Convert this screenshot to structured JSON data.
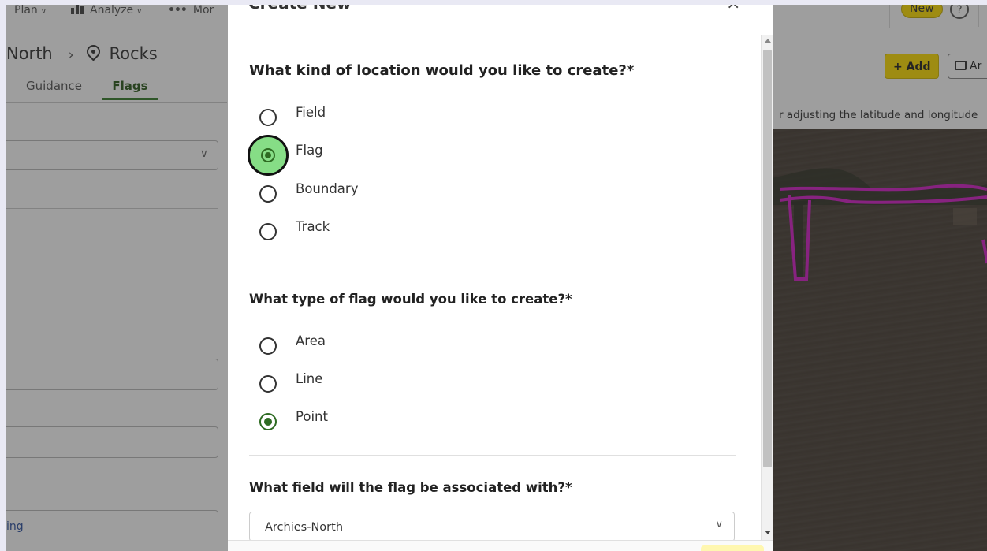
{
  "topbar": {
    "plan_label": "Plan",
    "analyze_label": "Analyze",
    "more_label": "Mor",
    "new_badge": "New",
    "help_icon": "?"
  },
  "breadcrumb": {
    "parent": "North",
    "separator": "›",
    "current": "Rocks"
  },
  "tabs": {
    "guidance": "Guidance",
    "flags": "Flags"
  },
  "sidebar": {
    "link_text": "ing"
  },
  "toolbar": {
    "add_label": "+ Add",
    "print_label": "Ar"
  },
  "map": {
    "hint_text": "r adjusting the latitude and longitude"
  },
  "modal": {
    "title": "Create New",
    "close_icon": "×",
    "question_location": "What kind of location would you like to create?*",
    "location_options": [
      {
        "label": "Field",
        "selected": false
      },
      {
        "label": "Flag",
        "selected": true
      },
      {
        "label": "Boundary",
        "selected": false
      },
      {
        "label": "Track",
        "selected": false
      }
    ],
    "question_flag_type": "What type of flag would you like to create?*",
    "flag_type_options": [
      {
        "label": "Area",
        "selected": false
      },
      {
        "label": "Line",
        "selected": false
      },
      {
        "label": "Point",
        "selected": true
      }
    ],
    "question_field": "What field will the flag be associated with?*",
    "field_select_value": "Archies-North"
  },
  "colors": {
    "accent_green": "#367c2b",
    "brand_yellow": "#ffde00",
    "highlight_green": "#86dd86",
    "boundary_magenta": "#d61fc9"
  }
}
